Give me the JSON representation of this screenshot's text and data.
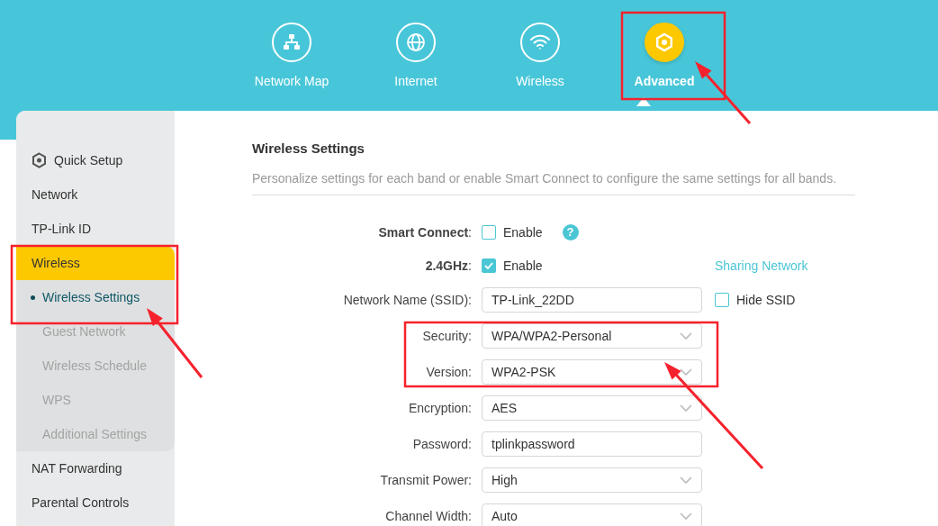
{
  "nav": [
    {
      "label": "Network Map",
      "kind": "map",
      "selected": false
    },
    {
      "label": "Internet",
      "kind": "internet",
      "selected": false
    },
    {
      "label": "Wireless",
      "kind": "wireless",
      "selected": false
    },
    {
      "label": "Advanced",
      "kind": "advanced",
      "selected": true
    }
  ],
  "sidebar": {
    "items": [
      {
        "label": "Quick Setup",
        "kind": "setup",
        "selected": false
      },
      {
        "label": "Network",
        "kind": "menu",
        "selected": false
      },
      {
        "label": "TP-Link ID",
        "kind": "menu",
        "selected": false
      },
      {
        "label": "Wireless",
        "kind": "menu",
        "selected": true,
        "children": [
          {
            "label": "Wireless Settings",
            "selected": true
          },
          {
            "label": "Guest Network",
            "selected": false
          },
          {
            "label": "Wireless Schedule",
            "selected": false
          },
          {
            "label": "WPS",
            "selected": false
          },
          {
            "label": "Additional Settings",
            "selected": false
          }
        ]
      },
      {
        "label": "NAT Forwarding",
        "kind": "menu",
        "selected": false
      },
      {
        "label": "Parental Controls",
        "kind": "menu",
        "selected": false
      }
    ]
  },
  "content": {
    "title": "Wireless Settings",
    "description": "Personalize settings for each band or enable Smart Connect to configure the same settings for all bands.",
    "rows": [
      {
        "kind": "checkbox",
        "label": "**Smart Connect**:",
        "option": "Enable",
        "checked": false,
        "help": "?"
      },
      {
        "kind": "checkbox",
        "label": "**2.4GHz**:",
        "option": "Enable",
        "checked": true,
        "link": "Sharing Network"
      },
      {
        "kind": "text",
        "label": "Network Name (SSID):",
        "value": "TP-Link_22DD",
        "extra_checkbox": {
          "option": "Hide SSID",
          "checked": false
        }
      },
      {
        "kind": "select",
        "label": "Security:",
        "value": "WPA/WPA2-Personal"
      },
      {
        "kind": "select",
        "label": "Version:",
        "value": "WPA2-PSK"
      },
      {
        "kind": "select",
        "label": "Encryption:",
        "value": "AES"
      },
      {
        "kind": "text",
        "label": "Password:",
        "value": "tplinkpassword"
      },
      {
        "kind": "select",
        "label": "Transmit Power:",
        "value": "High"
      },
      {
        "kind": "select",
        "label": "Channel Width:",
        "value": "Auto"
      }
    ]
  }
}
